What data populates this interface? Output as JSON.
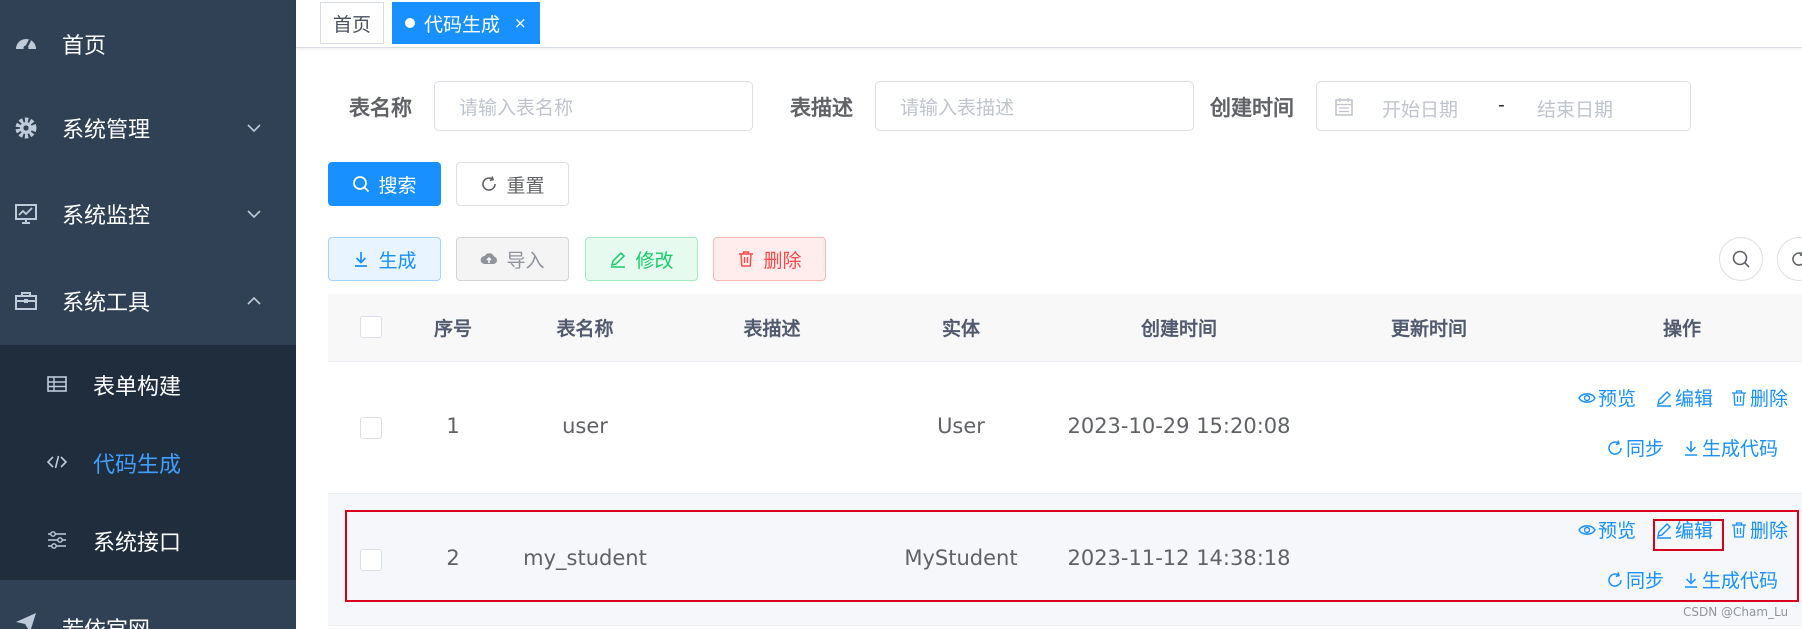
{
  "sidebar": {
    "home": "首页",
    "system_manage": "系统管理",
    "system_monitor": "系统监控",
    "system_tools": "系统工具",
    "sub_items": [
      "表单构建",
      "代码生成",
      "系统接口"
    ],
    "bottom": "若依官网"
  },
  "tags": {
    "home": "首页",
    "active": "代码生成",
    "close": "×"
  },
  "search": {
    "table_name_label": "表名称",
    "table_name_placeholder": "请输入表名称",
    "table_desc_label": "表描述",
    "table_desc_placeholder": "请输入表描述",
    "create_time_label": "创建时间",
    "start_date": "开始日期",
    "separator": "-",
    "end_date": "结束日期",
    "search_btn": "搜索",
    "reset_btn": "重置"
  },
  "toolbar": {
    "generate": "生成",
    "import": "导入",
    "edit": "修改",
    "delete": "删除"
  },
  "table": {
    "headers": [
      "序号",
      "表名称",
      "表描述",
      "实体",
      "创建时间",
      "更新时间",
      "操作"
    ],
    "rows": [
      {
        "index": "1",
        "name": "user",
        "desc": "",
        "entity": "User",
        "created": "2023-10-29 15:20:08",
        "updated": ""
      },
      {
        "index": "2",
        "name": "my_student",
        "desc": "",
        "entity": "MyStudent",
        "created": "2023-11-12 14:38:18",
        "updated": ""
      }
    ],
    "ops": {
      "preview": "预览",
      "edit": "编辑",
      "delete": "删除",
      "sync": "同步",
      "gen_code": "生成代码"
    }
  },
  "watermark": "CSDN @Cham_Lu",
  "colors": {
    "sidebar": "#304156",
    "submenu": "#1f2d3d",
    "primary": "#1890ff",
    "highlight": "#d9001b"
  }
}
